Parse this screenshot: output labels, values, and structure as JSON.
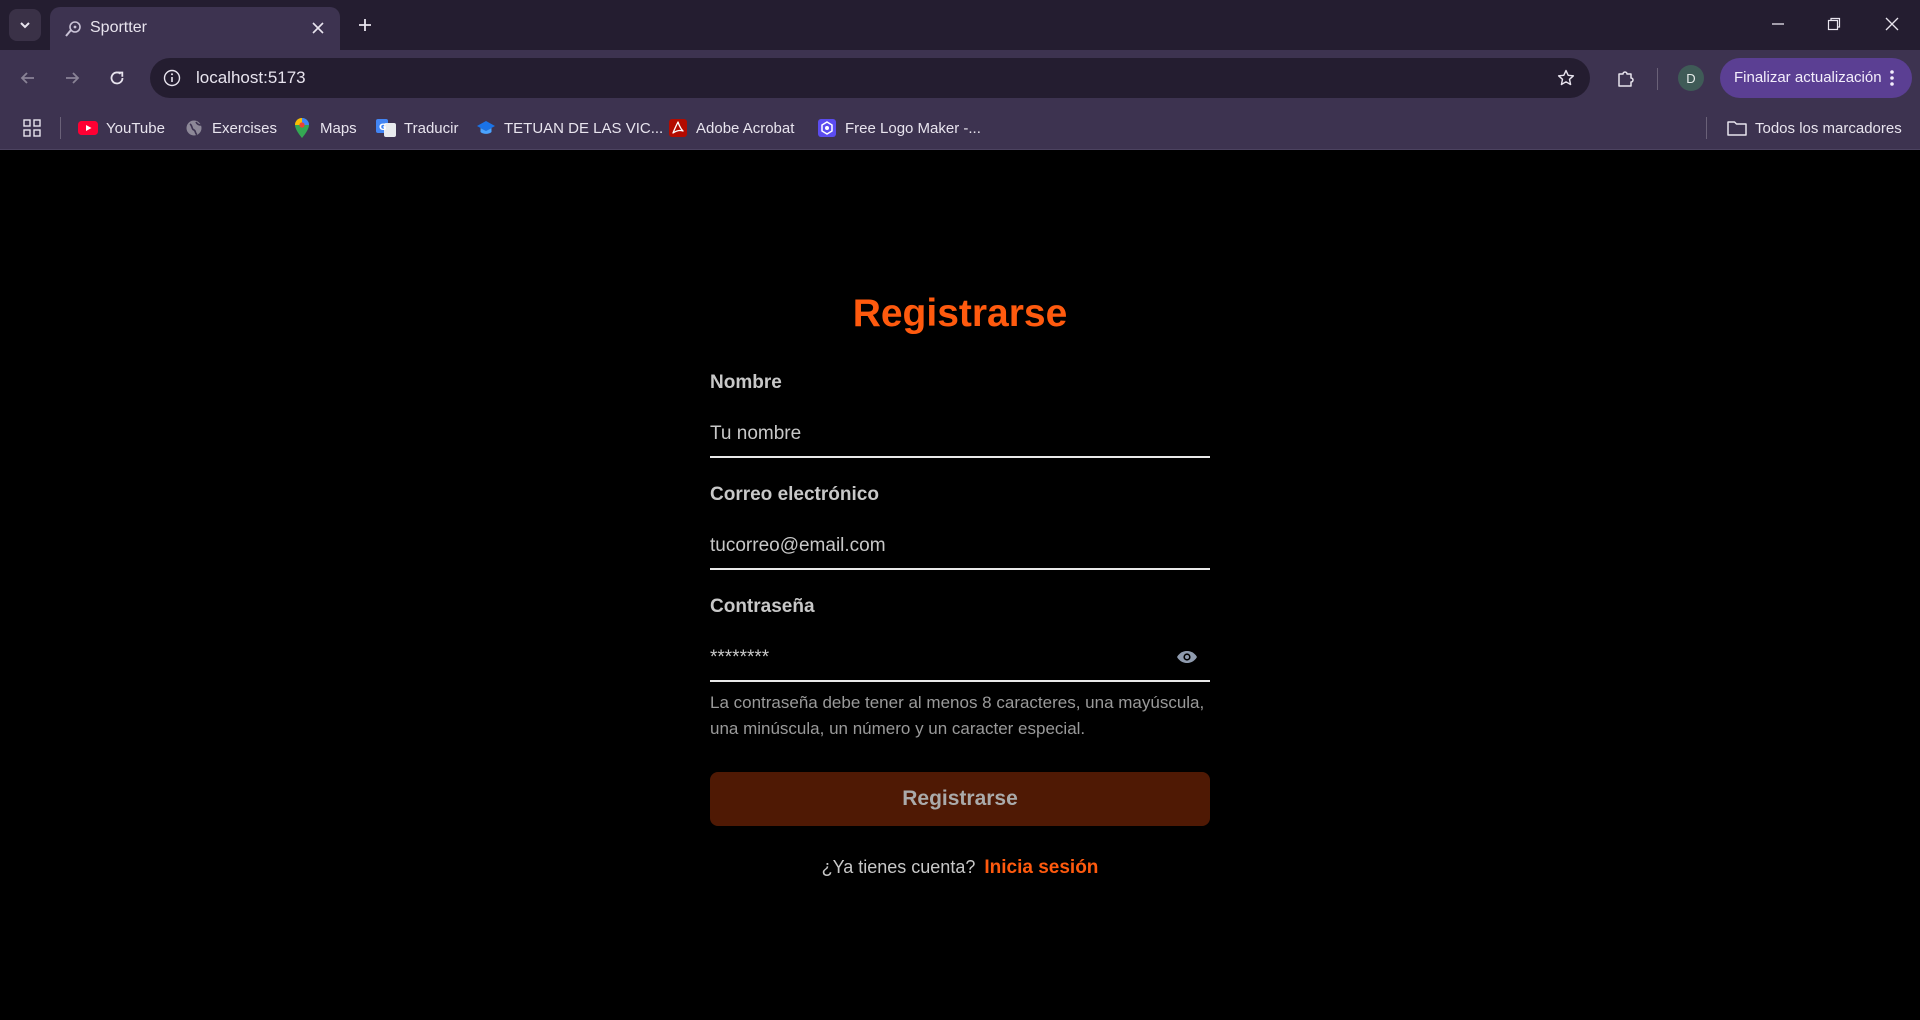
{
  "browser": {
    "tab_title": "Sportter",
    "url": "localhost:5173",
    "update_label": "Finalizar actualización",
    "avatar_letter": "D",
    "accent": "#5b3f93"
  },
  "bookmarks": [
    {
      "label": "YouTube",
      "icon": "youtube-icon"
    },
    {
      "label": "Exercises",
      "icon": "globe-icon"
    },
    {
      "label": "Maps",
      "icon": "maps-icon"
    },
    {
      "label": "Traducir",
      "icon": "translate-icon"
    },
    {
      "label": "TETUAN DE LAS VIC...",
      "icon": "graduation-cap-icon"
    },
    {
      "label": "Adobe Acrobat",
      "icon": "acrobat-icon"
    },
    {
      "label": "Free Logo Maker -...",
      "icon": "logo-maker-icon"
    }
  ],
  "all_bookmarks_label": "Todos los marcadores",
  "form": {
    "title": "Registrarse",
    "name_label": "Nombre",
    "name_placeholder": "Tu nombre",
    "email_label": "Correo electrónico",
    "email_placeholder": "tucorreo@email.com",
    "password_label": "Contraseña",
    "password_placeholder": "********",
    "password_hint": "La contraseña debe tener al menos 8 caracteres, una mayúscula, una minúscula, un número y un caracter especial.",
    "submit_label": "Registrarse",
    "login_prompt": "¿Ya tienes cuenta?",
    "login_link": "Inicia sesión",
    "accent_color": "#ff5a0e",
    "button_color": "#4f1904"
  }
}
